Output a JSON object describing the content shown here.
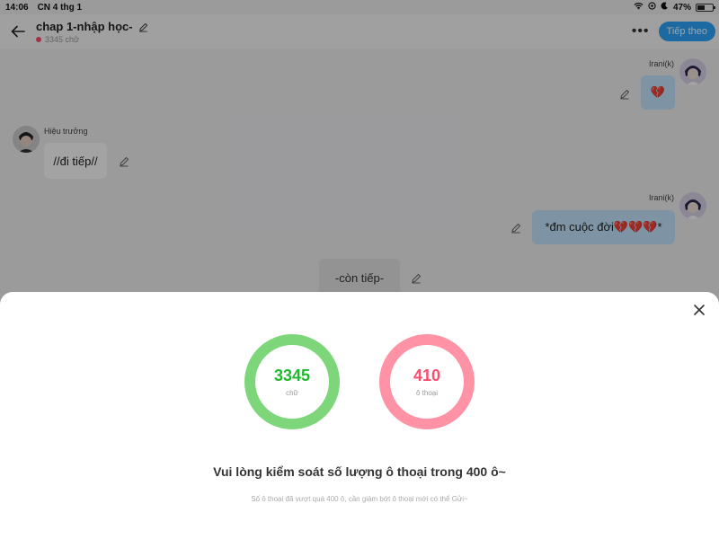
{
  "status": {
    "time": "14:06",
    "date": "CN 4 thg 1",
    "battery": "47%",
    "battery_level": 0.47
  },
  "header": {
    "title": "chap 1-nhập học-",
    "word_count": "3345 chữ",
    "more_label": "•••",
    "next_label": "Tiếp theo"
  },
  "chat": {
    "messages": [
      {
        "speaker": "Irani(k)",
        "text": "💔",
        "side": "right"
      },
      {
        "speaker": "Hiệu trưởng",
        "text": "//đi tiếp//",
        "side": "left"
      },
      {
        "speaker": "Irani(k)",
        "text_prefix": "*đm cuộc đời",
        "text_hearts": "💔💔💔",
        "text_suffix": "*",
        "side": "right"
      },
      {
        "text": "-còn tiếp-",
        "side": "center"
      }
    ]
  },
  "sheet": {
    "words_value": "3345",
    "words_label": "chữ",
    "dialogs_value": "410",
    "dialogs_label": "ô thoại",
    "title": "Vui lòng kiểm soát số lượng ô thoại trong 400 ô~",
    "subtitle": "Số ô thoại đã vượt quá 400 ô, cần giảm bớt ô thoại mới có thể Gửi~"
  },
  "colors": {
    "accent": "#2ea6ff",
    "green_ring": "#7ed67a",
    "pink_ring": "#ff92a4",
    "green_text": "#1dbb2b",
    "pink_text": "#ff4b6e",
    "bubble_right": "#c6e6ff"
  }
}
